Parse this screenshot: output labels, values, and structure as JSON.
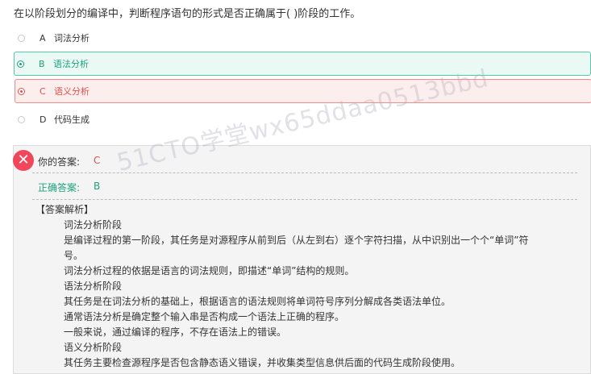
{
  "question": "在以阶段划分的编译中，判断程序语句的形式是否正确属于( )阶段的工作。",
  "options": [
    {
      "key": "A",
      "text": "词法分析"
    },
    {
      "key": "B",
      "text": "语法分析"
    },
    {
      "key": "C",
      "text": "语义分析"
    },
    {
      "key": "D",
      "text": "代码生成"
    }
  ],
  "result": {
    "your_label": "你的答案:",
    "your_answer": "C",
    "correct_label": "正确答案:",
    "correct_answer": "B"
  },
  "analysis_title": "【答案解析】",
  "analysis_lines": [
    "词法分析阶段",
    "是编译过程的第一阶段，其任务是对源程序从前到后（从左到右）逐个字符扫描，从中识别出一个个“单词”符",
    "号。",
    "词法分析过程的依据是语言的词法规则，即描述“单词”结构的规则。",
    "语法分析阶段",
    "其任务是在词法分析的基础上，根据语言的语法规则将单词符号序列分解成各类语法单位。",
    "通常语法分析是确定整个输入串是否构成一个语法上正确的程序。",
    "一般来说，通过编译的程序，不存在语法上的错误。",
    "语义分析阶段",
    "其任务主要检查源程序是否包含静态语义错误，并收集类型信息供后面的代码生成阶段使用。"
  ],
  "watermark": "51CTO学堂wx65ddaa0513bbd",
  "colors": {
    "correct": "#1da27a",
    "wrong": "#e05050",
    "badge": "#f0485a"
  }
}
